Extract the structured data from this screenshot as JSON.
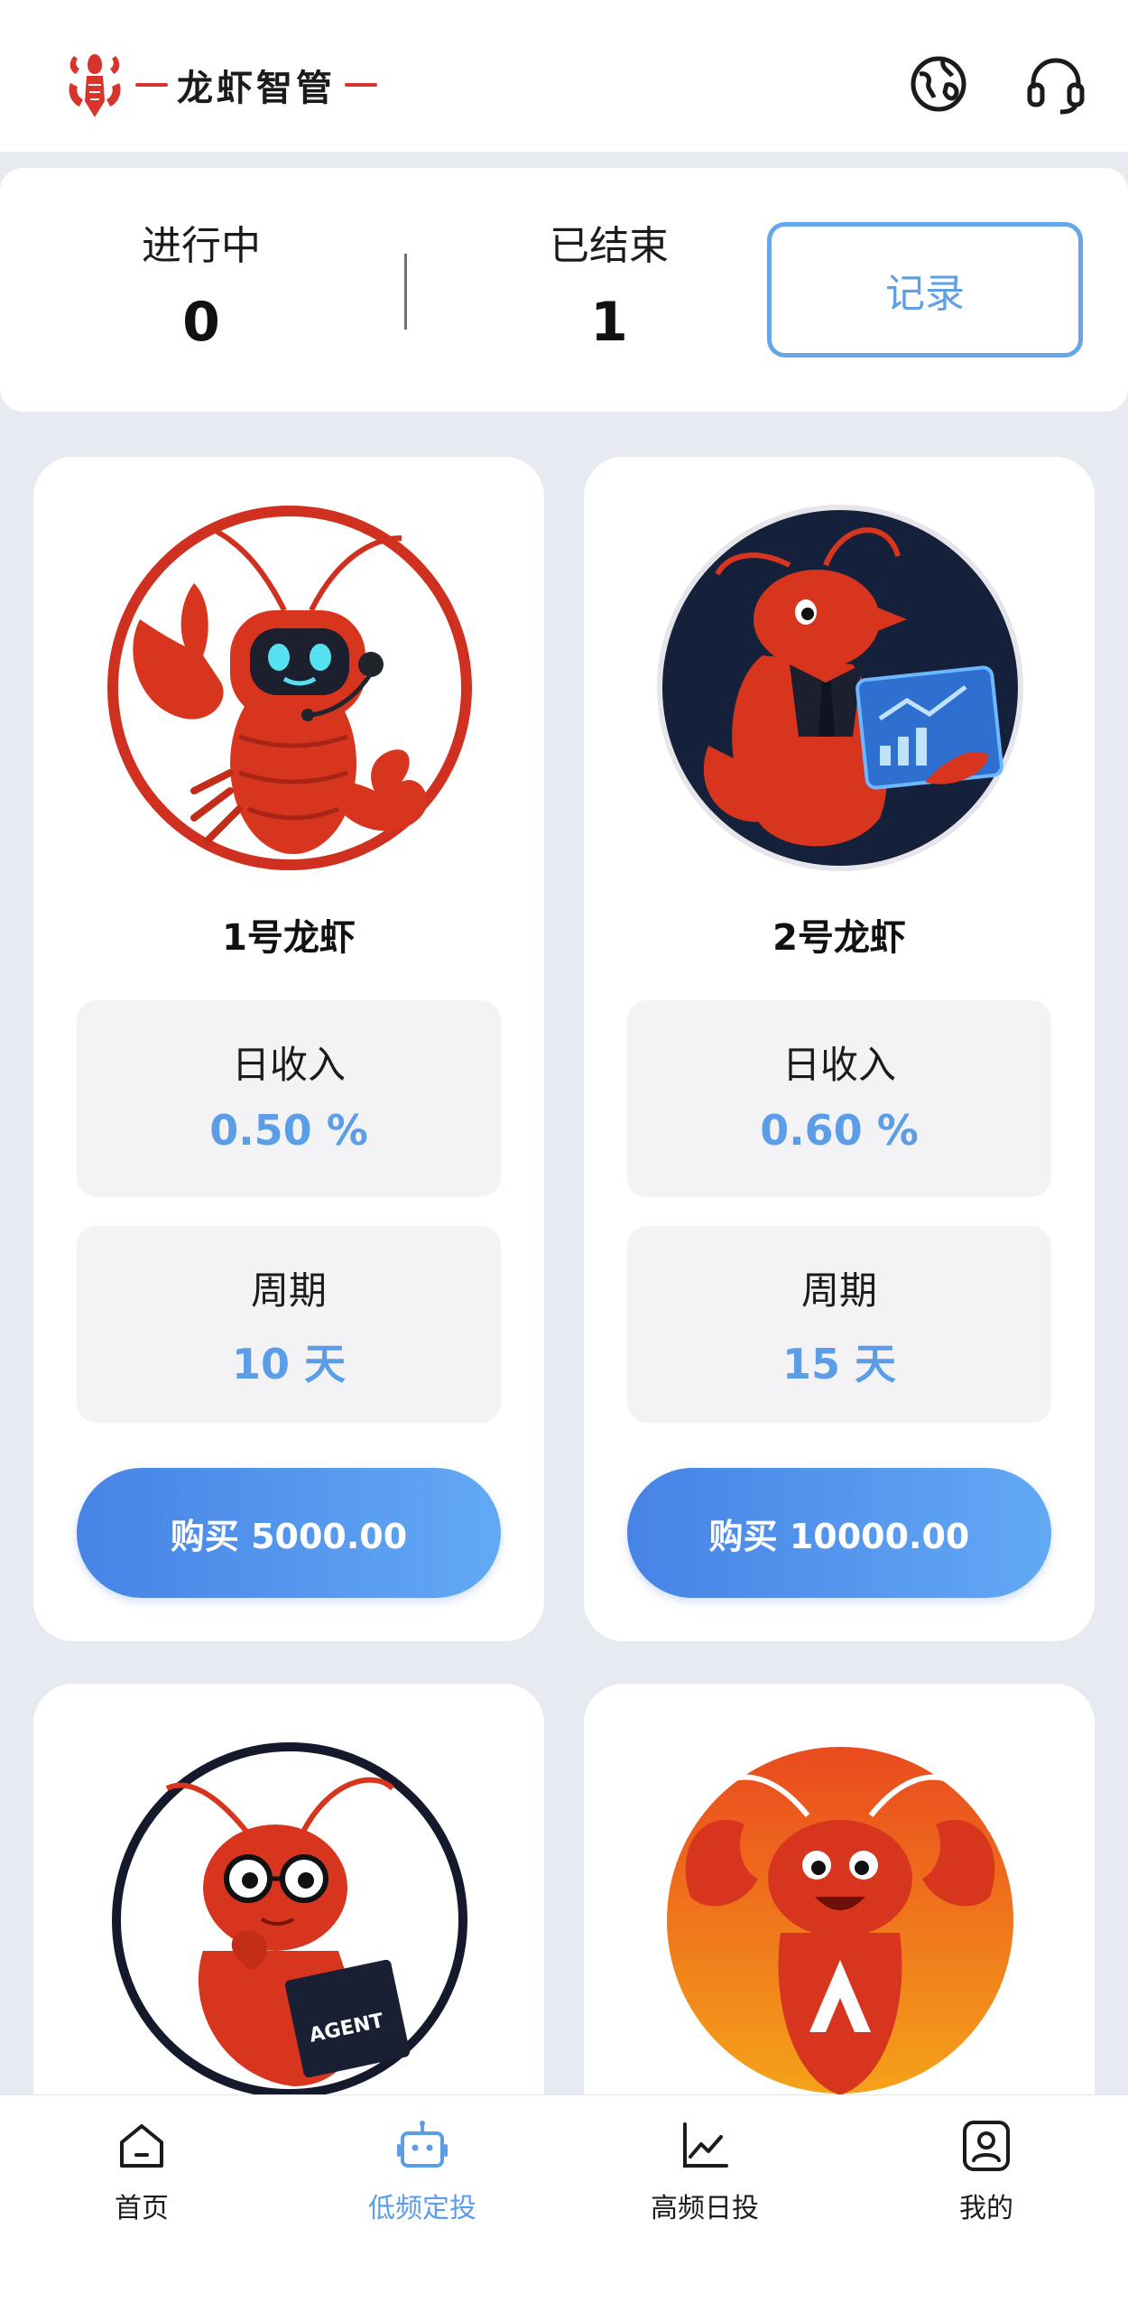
{
  "header": {
    "app_title": "龙虾智管"
  },
  "stats": {
    "in_progress_label": "进行中",
    "in_progress_value": "0",
    "ended_label": "已结束",
    "ended_value": "1",
    "record_label": "记录"
  },
  "products": [
    {
      "name": "1号龙虾",
      "daily_label": "日收入",
      "daily_value": "0.50 %",
      "period_label": "周期",
      "period_value": "10 天",
      "buy_label": "购买 5000.00"
    },
    {
      "name": "2号龙虾",
      "daily_label": "日收入",
      "daily_value": "0.60 %",
      "period_label": "周期",
      "period_value": "15 天",
      "buy_label": "购买 10000.00"
    }
  ],
  "avatar_text": {
    "book": "AGENT"
  },
  "nav": [
    {
      "label": "首页",
      "icon": "home-icon",
      "active": false
    },
    {
      "label": "低频定投",
      "icon": "robot-icon",
      "active": true
    },
    {
      "label": "高频日投",
      "icon": "line-chart-icon",
      "active": false
    },
    {
      "label": "我的",
      "icon": "profile-icon",
      "active": false
    }
  ],
  "colors": {
    "accent": "#5b9de6",
    "brand_red": "#d8342c",
    "background": "#e7eaf1"
  }
}
